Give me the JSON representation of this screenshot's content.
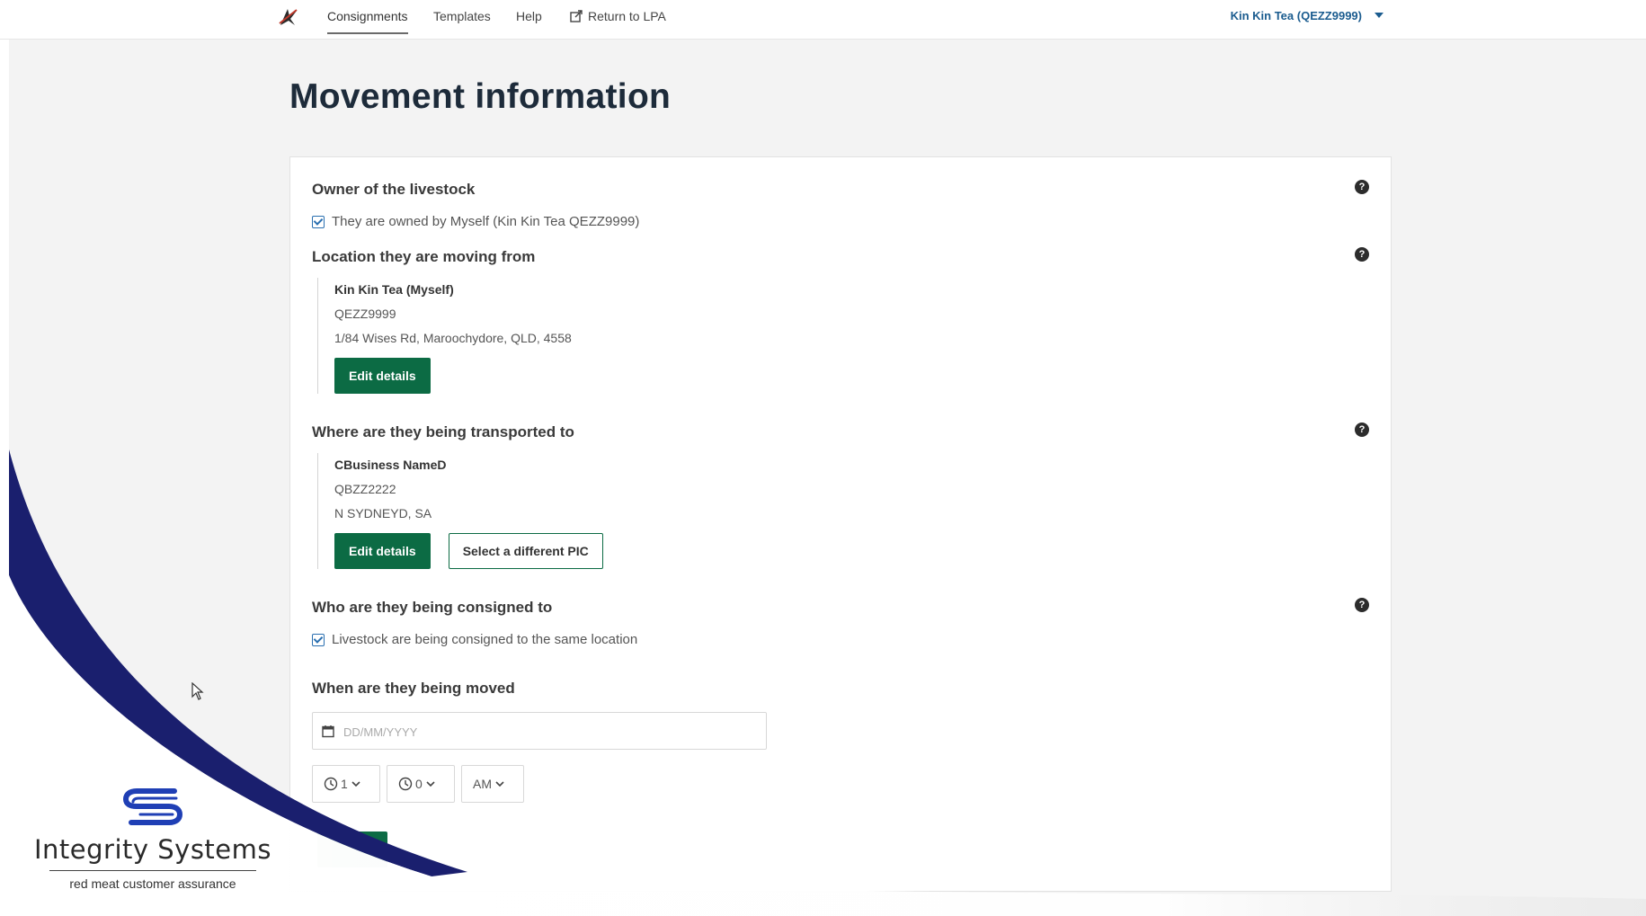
{
  "nav": {
    "items": [
      {
        "label": "Consignments",
        "active": true
      },
      {
        "label": "Templates"
      },
      {
        "label": "Help"
      },
      {
        "label": "Return to LPA",
        "icon": "external-link-icon"
      }
    ],
    "user": "Kin Kin Tea (QEZZ9999)"
  },
  "page": {
    "title": "Movement information"
  },
  "owner": {
    "title": "Owner of the livestock",
    "checkbox_label": "They are owned by Myself (Kin Kin Tea QEZZ9999)",
    "checked": true
  },
  "from": {
    "title": "Location they are moving from",
    "name": "Kin Kin Tea (Myself)",
    "pic": "QEZZ9999",
    "address": "1/84 Wises Rd, Maroochydore, QLD, 4558",
    "edit_label": "Edit details"
  },
  "to": {
    "title": "Where are they being transported to",
    "name": "CBusiness NameD",
    "pic": "QBZZ2222",
    "address": "N SYDNEYD, SA",
    "edit_label": "Edit details",
    "select_label": "Select a different PIC"
  },
  "consigned": {
    "title": "Who are they being consigned to",
    "checkbox_label": "Livestock are being consigned to the same location",
    "checked": true
  },
  "when": {
    "title": "When are they being moved",
    "date_placeholder": "DD/MM/YYYY",
    "hour": "1",
    "minute": "0",
    "ampm": "AM"
  },
  "help_symbol": "?",
  "brand": {
    "name": "Integrity Systems",
    "tagline": "red meat customer assurance"
  },
  "colors": {
    "primary_green": "#0c6b44",
    "user_blue": "#1b5c8f",
    "swoosh_navy": "#1a1f6e"
  }
}
